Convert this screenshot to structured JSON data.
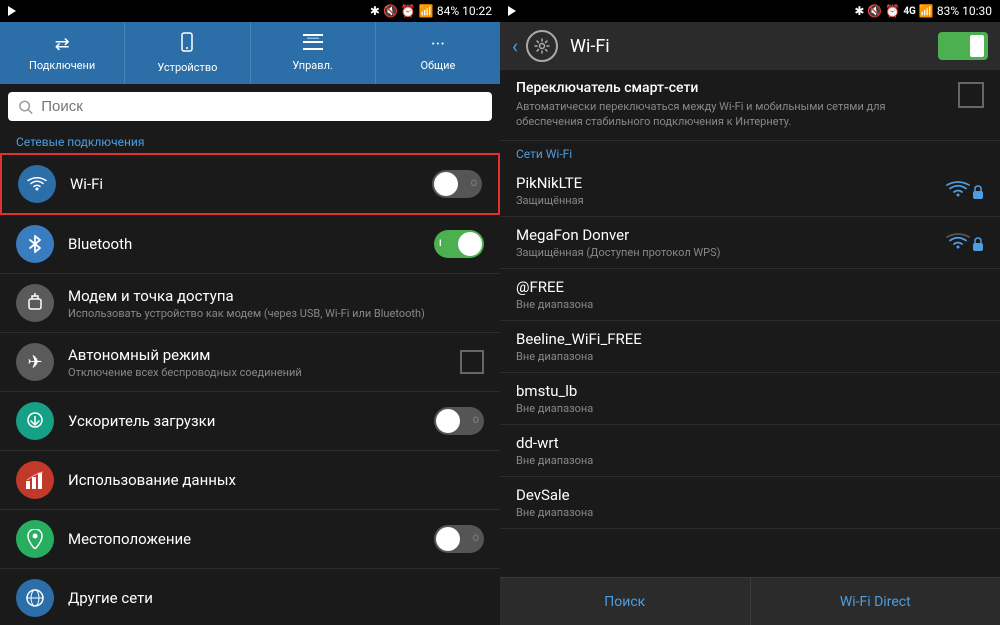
{
  "left": {
    "statusBar": {
      "time": "10:22",
      "battery": "84%",
      "icons": "bluetooth signal alarm volume"
    },
    "tabs": [
      {
        "id": "connections",
        "label": "Подключени",
        "icon": "⇄"
      },
      {
        "id": "device",
        "label": "Устройство",
        "icon": "📱"
      },
      {
        "id": "manage",
        "label": "Управл.",
        "icon": "≡"
      },
      {
        "id": "general",
        "label": "Общие",
        "icon": "···"
      }
    ],
    "search": {
      "placeholder": "Поиск"
    },
    "sectionHeader": "Сетевые подключения",
    "items": [
      {
        "id": "wifi",
        "icon": "wifi",
        "iconSymbol": "📶",
        "iconColor": "icon-blue",
        "title": "Wi-Fi",
        "subtitle": "",
        "toggle": "off",
        "highlighted": true
      },
      {
        "id": "bluetooth",
        "icon": "bluetooth",
        "iconSymbol": "⚡",
        "iconColor": "icon-blue-bt",
        "title": "Bluetooth",
        "subtitle": "",
        "toggle": "on",
        "highlighted": false
      },
      {
        "id": "modem",
        "icon": "modem",
        "iconSymbol": "🔒",
        "iconColor": "icon-gray",
        "title": "Модем и точка доступа",
        "subtitle": "Использовать устройство как модем (через USB, Wi-Fi или Bluetooth)",
        "toggle": null,
        "highlighted": false
      },
      {
        "id": "airplane",
        "icon": "airplane",
        "iconSymbol": "✈",
        "iconColor": "icon-gray",
        "title": "Автономный режим",
        "subtitle": "Отключение всех беспроводных соединений",
        "toggle": null,
        "checkbox": true,
        "highlighted": false
      },
      {
        "id": "download",
        "icon": "download",
        "iconSymbol": "⬇",
        "iconColor": "icon-teal",
        "title": "Ускоритель загрузки",
        "subtitle": "",
        "toggle": "off",
        "highlighted": false
      },
      {
        "id": "data",
        "icon": "data",
        "iconSymbol": "📊",
        "iconColor": "icon-red",
        "title": "Использование данных",
        "subtitle": "",
        "toggle": null,
        "highlighted": false
      },
      {
        "id": "location",
        "icon": "location",
        "iconSymbol": "📍",
        "iconColor": "icon-green",
        "title": "Местоположение",
        "subtitle": "",
        "toggle": "off",
        "highlighted": false
      },
      {
        "id": "other",
        "icon": "other",
        "iconSymbol": "🌐",
        "iconColor": "icon-blue",
        "title": "Другие сети",
        "subtitle": "",
        "toggle": null,
        "highlighted": false
      }
    ]
  },
  "right": {
    "statusBar": {
      "time": "10:30",
      "battery": "83%",
      "icons": "bluetooth signal 4g alarm volume"
    },
    "header": {
      "backLabel": "‹",
      "title": "Wi-Fi",
      "toggleState": "on"
    },
    "smartSwitch": {
      "title": "Переключатель смарт-сети",
      "description": "Автоматически переключаться между Wi-Fi и мобильными сетями для обеспечения стабильного подключения к Интернету."
    },
    "networksHeader": "Сети Wi-Fi",
    "networks": [
      {
        "id": "piknik",
        "name": "PikNikLTE",
        "status": "Защищённая",
        "signal": "full",
        "secured": true
      },
      {
        "id": "megafon",
        "name": "MegaFon Donver",
        "status": "Защищённая (Доступен протокол WPS)",
        "signal": "medium",
        "secured": true
      },
      {
        "id": "free",
        "name": "@FREE",
        "status": "Вне диапазона",
        "signal": "none",
        "secured": false
      },
      {
        "id": "beeline",
        "name": "Beeline_WiFi_FREE",
        "status": "Вне диапазона",
        "signal": "none",
        "secured": false
      },
      {
        "id": "bmstu",
        "name": "bmstu_lb",
        "status": "Вне диапазона",
        "signal": "none",
        "secured": false
      },
      {
        "id": "ddwrt",
        "name": "dd-wrt",
        "status": "Вне диапазона",
        "signal": "none",
        "secured": false
      },
      {
        "id": "devsale",
        "name": "DevSale",
        "status": "Вне диапазона",
        "signal": "none",
        "secured": false
      }
    ],
    "bottomButtons": [
      {
        "id": "search",
        "label": "Поиск"
      },
      {
        "id": "wifidirect",
        "label": "Wi-Fi Direct"
      }
    ]
  }
}
